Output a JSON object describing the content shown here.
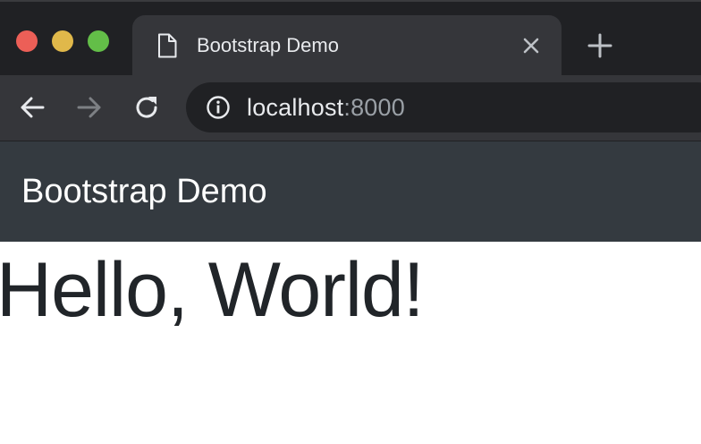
{
  "window": {
    "traffic_lights": [
      "close",
      "minimize",
      "maximize"
    ],
    "colors": {
      "close": "#ec5f57",
      "minimize": "#e0b84a",
      "maximize": "#63be48"
    }
  },
  "tab": {
    "title": "Bootstrap Demo",
    "icon": "file-icon",
    "close_icon": "close-icon"
  },
  "new_tab_icon": "plus-icon",
  "toolbar": {
    "back_icon": "arrow-left-icon",
    "forward_icon": "arrow-right-icon",
    "forward_enabled": false,
    "reload_icon": "reload-icon",
    "security_icon": "info-icon",
    "url_host": "localhost",
    "url_port": ":8000"
  },
  "page": {
    "navbar": {
      "brand": "Bootstrap Demo",
      "background": "#343a40"
    },
    "heading": "Hello, World!"
  }
}
